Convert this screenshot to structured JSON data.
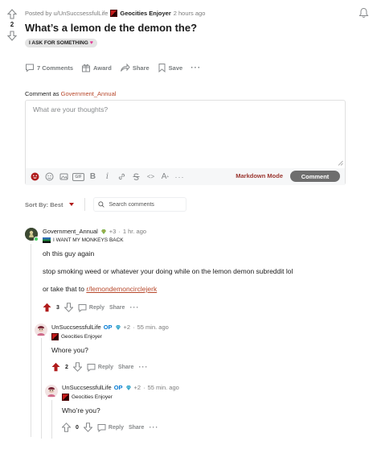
{
  "post": {
    "score": "2",
    "posted_by": "Posted by u/UnSuccsessfulLife",
    "author_flair": "Geocities Enjoyer",
    "time_ago": "2 hours ago",
    "title": "What’s a lemon de the demon the?",
    "flair": "I ASK FOR SOMETHING",
    "actions": {
      "comments": "7 Comments",
      "award": "Award",
      "share": "Share",
      "save": "Save"
    }
  },
  "comment_box": {
    "comment_as_label": "Comment as",
    "comment_as_user": "Government_Annual",
    "placeholder": "What are your thoughts?",
    "markdown_mode": "Markdown Mode",
    "submit": "Comment",
    "toolbar": [
      "emoji-icon",
      "sticker-icon",
      "image-icon",
      "gif-icon",
      "bold-icon",
      "italic-icon",
      "link-icon",
      "strikethrough-icon",
      "inline-code-icon",
      "superscript-icon",
      "more-icon"
    ],
    "toolbar_text": {
      "gif": "GIF",
      "bold": "B",
      "italic": "i",
      "code": "<>",
      "superscript": "A",
      "more": "···"
    }
  },
  "sort": {
    "label": "Sort By: Best",
    "search_placeholder": "Search comments"
  },
  "comments": [
    {
      "author": "Government_Annual",
      "points": "+3",
      "time": "1 hr. ago",
      "flair": "I WANT MY MONKEYS BACK",
      "body": [
        "oh this guy again",
        "stop smoking weed or whatever your doing while on the lemon demon subreddit lol",
        "or take that to "
      ],
      "link": "r/lemondemoncirclejerk",
      "score": "3",
      "reply": "Reply",
      "share": "Share"
    },
    {
      "author": "UnSuccsessfulLife",
      "op": "OP",
      "points": "+2",
      "time": "55 min. ago",
      "flair": "Geocities Enjoyer",
      "body": "Whore you?",
      "score": "2",
      "reply": "Reply",
      "share": "Share"
    },
    {
      "author": "UnSuccsessfulLife",
      "op": "OP",
      "points": "+2",
      "time": "55 min. ago",
      "flair": "Geocities Enjoyer",
      "body": "Who’re you?",
      "score": "0",
      "reply": "Reply",
      "share": "Share"
    }
  ],
  "colors": {
    "accent_red": "#b01c1c",
    "link": "#b7472a",
    "op_blue": "#0079d3",
    "comment_button": "#6e6e6e"
  }
}
